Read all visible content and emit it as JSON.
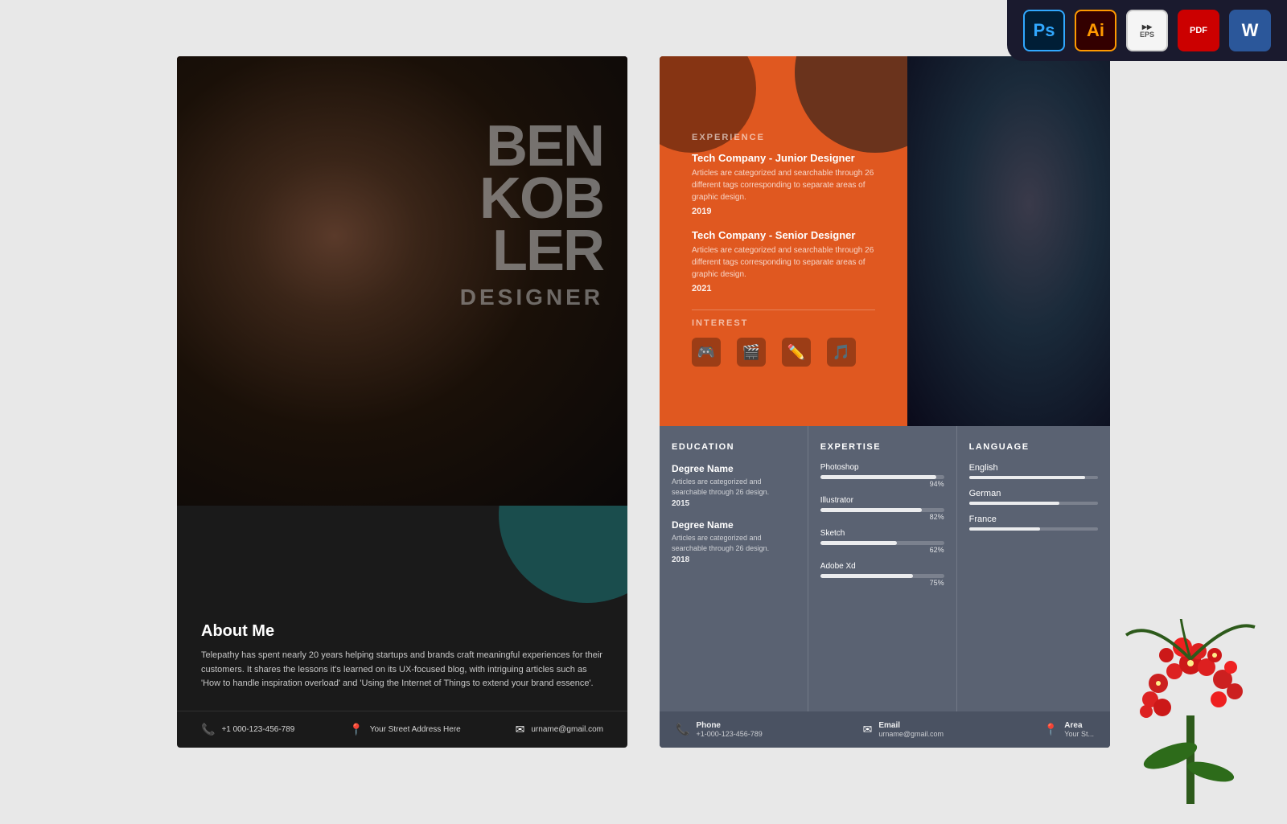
{
  "toolbar": {
    "tools": [
      {
        "id": "ps",
        "label": "Ps",
        "type": "ps"
      },
      {
        "id": "ai",
        "label": "Ai",
        "type": "ai"
      },
      {
        "id": "eps",
        "label": "EPS",
        "type": "eps"
      },
      {
        "id": "pdf",
        "label": "PDF",
        "type": "pdf"
      },
      {
        "id": "word",
        "label": "W",
        "type": "word"
      }
    ]
  },
  "left_card": {
    "name_lines": [
      "BEN",
      "KOB",
      "LER"
    ],
    "title": "DESIGNER",
    "about_title": "About Me",
    "about_text": "Telepathy has spent nearly 20 years helping startups and brands craft meaningful experiences for their customers. It shares the lessons it's learned on its UX-focused blog, with intriguing articles such as 'How to handle inspiration overload' and 'Using the Internet of Things to extend your brand essence'.",
    "contact": {
      "phone": "+1 000-123-456-789",
      "address": "Your Street Address Here",
      "email": "urname@gmail.com"
    }
  },
  "right_card": {
    "experience_label": "EXPERIENCE",
    "experience": [
      {
        "company": "Tech Company - Junior Designer",
        "desc": "Articles are categorized and searchable through 26 different tags corresponding to separate areas of graphic design.",
        "year": "2019"
      },
      {
        "company": "Tech Company - Senior Designer",
        "desc": "Articles are categorized and searchable through 26 different tags corresponding to separate areas of graphic design.",
        "year": "2021"
      }
    ],
    "interest_label": "INTEREST",
    "interests": [
      "🎮",
      "🎬",
      "✏️",
      "🎵"
    ],
    "education_label": "EDUCATION",
    "education": [
      {
        "degree": "Degree Name",
        "desc": "Articles are categorized and searchable through 26 design.",
        "year": "2015"
      },
      {
        "degree": "Degree Name",
        "desc": "Articles are categorized and searchable through 26 design.",
        "year": "2018"
      }
    ],
    "expertise_label": "EXPERTISE",
    "skills": [
      {
        "name": "Photoshop",
        "pct": 94
      },
      {
        "name": "Illustrator",
        "pct": 82
      },
      {
        "name": "Sketch",
        "pct": 62
      },
      {
        "name": "Adobe Xd",
        "pct": 75
      }
    ],
    "language_label": "LANGUAGE",
    "languages": [
      {
        "name": "English",
        "pct": 90
      },
      {
        "name": "German",
        "pct": 70
      },
      {
        "name": "France",
        "pct": 55
      }
    ],
    "contact": {
      "phone_label": "Phone",
      "phone": "+1-000-123-456-789",
      "email_label": "Email",
      "email": "urname@gmail.com",
      "area_label": "Area",
      "area": "Your St..."
    }
  }
}
